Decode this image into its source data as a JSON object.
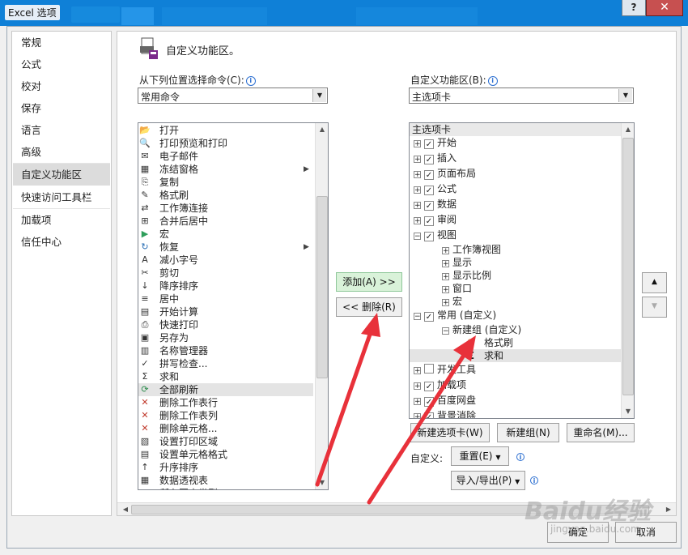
{
  "window": {
    "title": "Excel 选项",
    "help": "?",
    "close": "✕"
  },
  "nav": {
    "items": [
      {
        "label": "常规"
      },
      {
        "label": "公式"
      },
      {
        "label": "校对"
      },
      {
        "label": "保存"
      },
      {
        "label": "语言"
      },
      {
        "label": "高级"
      },
      {
        "label": "自定义功能区"
      },
      {
        "label": "快速访问工具栏"
      },
      {
        "label": "加载项"
      },
      {
        "label": "信任中心"
      }
    ]
  },
  "header": {
    "title": "自定义功能区。"
  },
  "left": {
    "label": "从下列位置选择命令(C):",
    "selected": "常用命令",
    "commands": [
      {
        "label": "打开",
        "icon": "folder-icon"
      },
      {
        "label": "打印预览和打印",
        "icon": "print-preview-icon"
      },
      {
        "label": "电子邮件",
        "icon": "email-icon"
      },
      {
        "label": "冻结窗格",
        "icon": "freeze-panes-icon",
        "submenu": true
      },
      {
        "label": "复制",
        "icon": "copy-icon"
      },
      {
        "label": "格式刷",
        "icon": "format-painter-icon"
      },
      {
        "label": "工作簿连接",
        "icon": "connections-icon"
      },
      {
        "label": "合并后居中",
        "icon": "merge-center-icon"
      },
      {
        "label": "宏",
        "icon": "macro-icon"
      },
      {
        "label": "恢复",
        "icon": "redo-icon",
        "submenu": true
      },
      {
        "label": "减小字号",
        "icon": "decrease-font-icon"
      },
      {
        "label": "剪切",
        "icon": "cut-icon"
      },
      {
        "label": "降序排序",
        "icon": "sort-desc-icon"
      },
      {
        "label": "居中",
        "icon": "center-align-icon"
      },
      {
        "label": "开始计算",
        "icon": "calculate-icon"
      },
      {
        "label": "快速打印",
        "icon": "quick-print-icon"
      },
      {
        "label": "另存为",
        "icon": "save-as-icon"
      },
      {
        "label": "名称管理器",
        "icon": "name-manager-icon"
      },
      {
        "label": "拼写检查...",
        "icon": "spelling-icon"
      },
      {
        "label": "求和",
        "icon": "sum-icon"
      },
      {
        "label": "全部刷新",
        "icon": "refresh-all-icon"
      },
      {
        "label": "删除工作表行",
        "icon": "delete-row-icon"
      },
      {
        "label": "删除工作表列",
        "icon": "delete-column-icon"
      },
      {
        "label": "删除单元格...",
        "icon": "delete-cells-icon"
      },
      {
        "label": "设置打印区域",
        "icon": "print-area-icon"
      },
      {
        "label": "设置单元格格式",
        "icon": "format-cells-icon"
      },
      {
        "label": "升序排序",
        "icon": "sort-asc-icon"
      },
      {
        "label": "数据透视表",
        "icon": "pivot-table-icon"
      },
      {
        "label": "所有图表类型",
        "icon": "chart-icon"
      }
    ],
    "selected_index": 20
  },
  "mid": {
    "add": "添加(A) >>",
    "remove": "<< 删除(R)"
  },
  "right": {
    "label": "自定义功能区(B):",
    "selected": "主选项卡",
    "header": "主选项卡",
    "tree": [
      {
        "label": "开始",
        "level": 0,
        "pm": "+",
        "check": true
      },
      {
        "label": "插入",
        "level": 0,
        "pm": "+",
        "check": true
      },
      {
        "label": "页面布局",
        "level": 0,
        "pm": "+",
        "check": true
      },
      {
        "label": "公式",
        "level": 0,
        "pm": "+",
        "check": true
      },
      {
        "label": "数据",
        "level": 0,
        "pm": "+",
        "check": true
      },
      {
        "label": "审阅",
        "level": 0,
        "pm": "+",
        "check": true
      },
      {
        "label": "视图",
        "level": 0,
        "pm": "−",
        "check": true
      },
      {
        "label": "工作簿视图",
        "level": 1,
        "pm": "+"
      },
      {
        "label": "显示",
        "level": 1,
        "pm": "+"
      },
      {
        "label": "显示比例",
        "level": 1,
        "pm": "+"
      },
      {
        "label": "窗口",
        "level": 1,
        "pm": "+"
      },
      {
        "label": "宏",
        "level": 1,
        "pm": "+"
      },
      {
        "label": "常用 (自定义)",
        "level": 0,
        "pm": "−",
        "check": true
      },
      {
        "label": "新建组 (自定义)",
        "level": 1,
        "pm": "−"
      },
      {
        "label": "格式刷",
        "level": 2,
        "icon": "format-painter-icon"
      },
      {
        "label": "求和",
        "level": 2,
        "icon": "sum-icon",
        "selected": true
      },
      {
        "label": "开发工具",
        "level": 0,
        "pm": "+",
        "check": false
      },
      {
        "label": "加载项",
        "level": 0,
        "pm": "+",
        "check": true
      },
      {
        "label": "百度网盘",
        "level": 0,
        "pm": "+",
        "check": true
      },
      {
        "label": "背景消除",
        "level": 0,
        "pm": "+",
        "check": true
      }
    ],
    "buttons": {
      "new_tab": "新建选项卡(W)",
      "new_group": "新建组(N)",
      "rename": "重命名(M)..."
    },
    "customize_label": "自定义:",
    "reset": "重置(E)",
    "import_export": "导入/导出(P)"
  },
  "footer": {
    "ok": "确定",
    "cancel": "取消"
  },
  "watermark": {
    "main": "Baidu经验",
    "sub": "jingyan.baidu.com"
  },
  "colors": {
    "titlebar": "#0f80d7",
    "arrow": "#e8313a",
    "add_button": "#d9f2d9",
    "selection": "#e4e4e4"
  }
}
